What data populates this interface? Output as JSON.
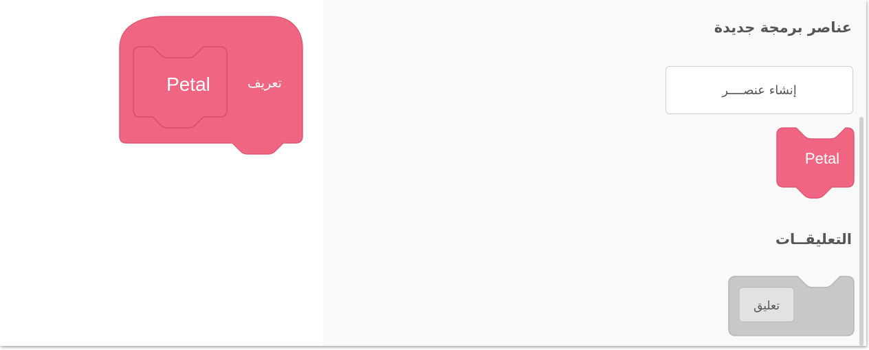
{
  "palette": {
    "my_blocks_title": "عناصر برمجة جديدة",
    "make_block_label": "إنشاء عنصــــر",
    "comments_title": "التعليقــات",
    "comment_block_label": "تعليق"
  },
  "workspace": {
    "define_label": "تعريف",
    "define_name": "Petal"
  },
  "palette_blocks": {
    "custom_block_label": "Petal"
  },
  "colors": {
    "custom_block": "#f06682",
    "custom_block_stroke": "#e05774",
    "comment_block": "#c8c8c8",
    "palette_bg": "#f9f9f9"
  }
}
